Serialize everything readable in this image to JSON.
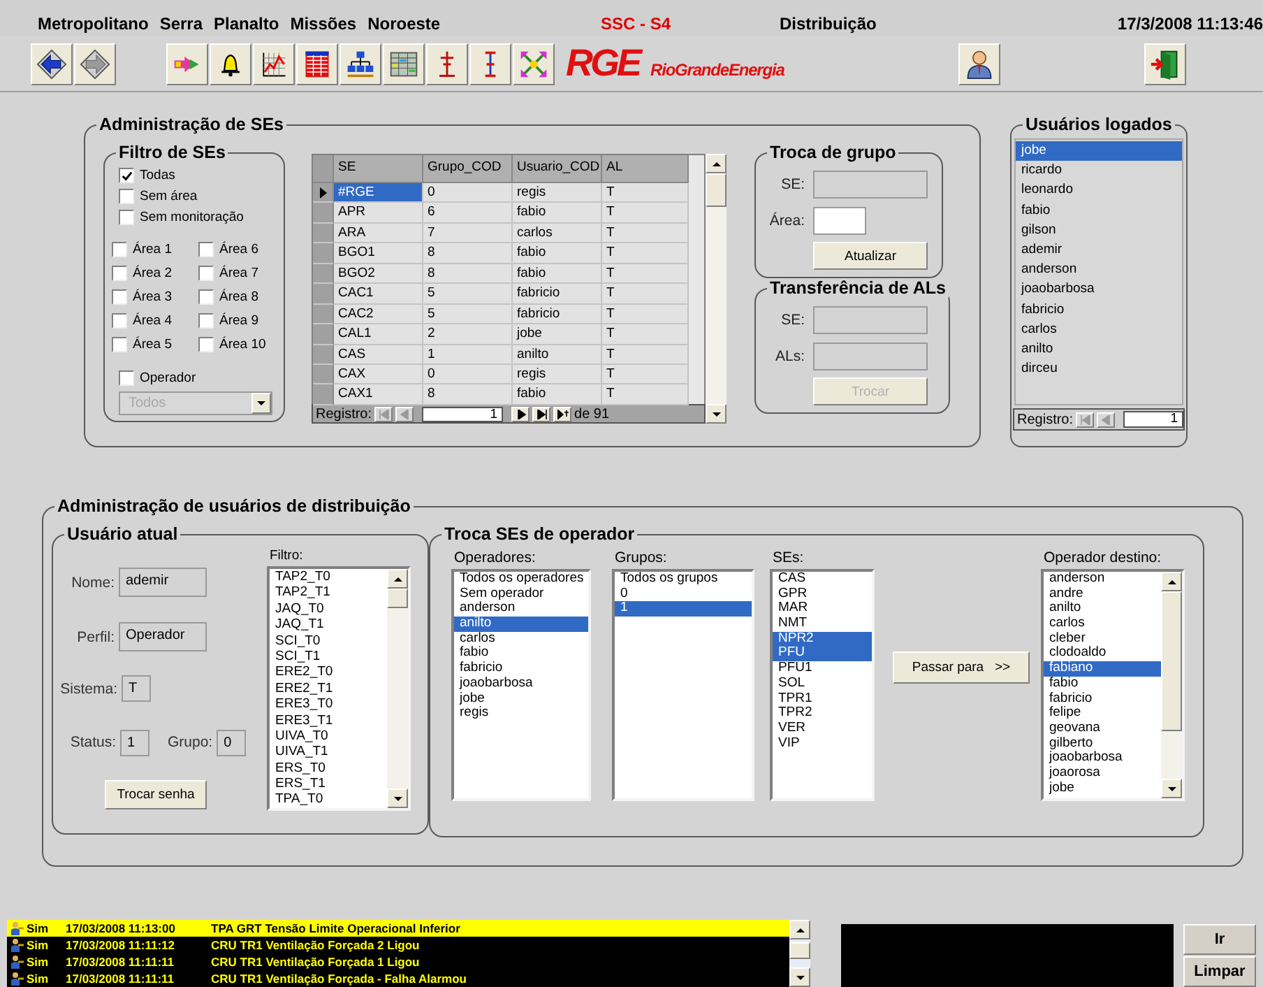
{
  "menu": [
    "Metropolitano",
    "Serra",
    "Planalto",
    "Missões",
    "Noroeste"
  ],
  "app_title": "SSC - S4",
  "module": "Distribuição",
  "datetime": "17/3/2008 11:13:46",
  "logo": {
    "mark": "RGE",
    "wordmark": "RioGrandeEnergia"
  },
  "se_admin": {
    "title": "Administração de SEs",
    "filter": {
      "title": "Filtro de SEs",
      "options": [
        {
          "label": "Todas",
          "checked": true
        },
        {
          "label": "Sem área",
          "checked": false
        },
        {
          "label": "Sem monitoração",
          "checked": false
        }
      ],
      "areas": [
        {
          "label": "Área 1",
          "checked": false
        },
        {
          "label": "Área 2",
          "checked": false
        },
        {
          "label": "Área 3",
          "checked": false
        },
        {
          "label": "Área 4",
          "checked": false
        },
        {
          "label": "Área 5",
          "checked": false
        },
        {
          "label": "Área 6",
          "checked": false
        },
        {
          "label": "Área 7",
          "checked": false
        },
        {
          "label": "Área 8",
          "checked": false
        },
        {
          "label": "Área 9",
          "checked": false
        },
        {
          "label": "Área 10",
          "checked": false
        }
      ],
      "operator": {
        "label": "Operador",
        "checked": false
      },
      "operator_select": {
        "value": "Todos",
        "disabled": true
      }
    },
    "table": {
      "columns": [
        "SE",
        "Grupo_COD",
        "Usuario_COD",
        "AL"
      ],
      "rows": [
        {
          "cells": [
            "#RGE",
            "0",
            "regis",
            "T"
          ],
          "selected": true
        },
        {
          "cells": [
            "APR",
            "6",
            "fabio",
            "T"
          ],
          "selected": false
        },
        {
          "cells": [
            "ARA",
            "7",
            "carlos",
            "T"
          ],
          "selected": false
        },
        {
          "cells": [
            "BGO1",
            "8",
            "fabio",
            "T"
          ],
          "selected": false
        },
        {
          "cells": [
            "BGO2",
            "8",
            "fabio",
            "T"
          ],
          "selected": false
        },
        {
          "cells": [
            "CAC1",
            "5",
            "fabricio",
            "T"
          ],
          "selected": false
        },
        {
          "cells": [
            "CAC2",
            "5",
            "fabricio",
            "T"
          ],
          "selected": false
        },
        {
          "cells": [
            "CAL1",
            "2",
            "jobe",
            "T"
          ],
          "selected": false
        },
        {
          "cells": [
            "CAS",
            "1",
            "anilto",
            "T"
          ],
          "selected": false
        },
        {
          "cells": [
            "CAX",
            "0",
            "regis",
            "T"
          ],
          "selected": false
        },
        {
          "cells": [
            "CAX1",
            "8",
            "fabio",
            "T"
          ],
          "selected": false
        }
      ],
      "navigator": {
        "label": "Registro:",
        "value": "1",
        "total": "de 91"
      }
    },
    "group_change": {
      "title": "Troca de grupo",
      "se_label": "SE:",
      "area_label": "Área:",
      "button": {
        "label": "Atualizar",
        "disabled": false
      }
    },
    "al_transfer": {
      "title": "Transferência de ALs",
      "se_label": "SE:",
      "als_label": "ALs:",
      "button": {
        "label": "Trocar",
        "disabled": true
      }
    }
  },
  "logged_users": {
    "title": "Usuários logados",
    "items": [
      {
        "label": "jobe",
        "selected": true
      },
      {
        "label": "ricardo",
        "selected": false
      },
      {
        "label": "leonardo",
        "selected": false
      },
      {
        "label": "fabio",
        "selected": false
      },
      {
        "label": "gilson",
        "selected": false
      },
      {
        "label": "ademir",
        "selected": false
      },
      {
        "label": "anderson",
        "selected": false
      },
      {
        "label": "joaobarbosa",
        "selected": false
      },
      {
        "label": "fabricio",
        "selected": false
      },
      {
        "label": "carlos",
        "selected": false
      },
      {
        "label": "anilto",
        "selected": false
      },
      {
        "label": "dirceu",
        "selected": false
      }
    ],
    "navigator": {
      "label": "Registro:",
      "value": "1"
    }
  },
  "user_admin": {
    "title": "Administração de usuários de distribuição",
    "current_user": {
      "title": "Usuário atual",
      "fields": [
        {
          "label": "Nome:",
          "value": "ademir"
        },
        {
          "label": "Perfil:",
          "value": "Operador"
        },
        {
          "label": "Sistema:",
          "value": "T"
        },
        {
          "label": "Status:",
          "value": "1"
        },
        {
          "label": "Grupo:",
          "value": "0"
        }
      ],
      "button": "Trocar senha",
      "filter_label": "Filtro:",
      "filter_items": [
        "TAP2_T0",
        "TAP2_T1",
        "JAQ_T0",
        "JAQ_T1",
        "SCI_T0",
        "SCI_T1",
        "ERE2_T0",
        "ERE2_T1",
        "ERE3_T0",
        "ERE3_T1",
        "UIVA_T0",
        "UIVA_T1",
        "ERS_T0",
        "ERS_T1",
        "TPA_T0"
      ]
    },
    "operator_change": {
      "title": "Troca SEs de operador",
      "lists": [
        {
          "label": "Operadores:",
          "items": [
            {
              "label": "Todos os operadores",
              "selected": false
            },
            {
              "label": "Sem operador",
              "selected": false
            },
            {
              "label": "anderson",
              "selected": false
            },
            {
              "label": "anilto",
              "selected": true
            },
            {
              "label": "carlos",
              "selected": false
            },
            {
              "label": "fabio",
              "selected": false
            },
            {
              "label": "fabricio",
              "selected": false
            },
            {
              "label": "joaobarbosa",
              "selected": false
            },
            {
              "label": "jobe",
              "selected": false
            },
            {
              "label": "regis",
              "selected": false
            }
          ]
        },
        {
          "label": "Grupos:",
          "items": [
            {
              "label": "Todos os grupos",
              "selected": false
            },
            {
              "label": "0",
              "selected": false
            },
            {
              "label": "1",
              "selected": true
            }
          ]
        },
        {
          "label": "SEs:",
          "items": [
            {
              "label": "CAS",
              "selected": false
            },
            {
              "label": "GPR",
              "selected": false
            },
            {
              "label": "MAR",
              "selected": false
            },
            {
              "label": "NMT",
              "selected": false
            },
            {
              "label": "NPR2",
              "selected": true
            },
            {
              "label": "PFU",
              "selected": true
            },
            {
              "label": "PFU1",
              "selected": false
            },
            {
              "label": "SOL",
              "selected": false
            },
            {
              "label": "TPR1",
              "selected": false
            },
            {
              "label": "TPR2",
              "selected": false
            },
            {
              "label": "VER",
              "selected": false
            },
            {
              "label": "VIP",
              "selected": false
            }
          ]
        }
      ],
      "button": "Passar para   >>",
      "destination": {
        "label": "Operador destino:",
        "items": [
          {
            "label": "anderson",
            "selected": false
          },
          {
            "label": "andre",
            "selected": false
          },
          {
            "label": "anilto",
            "selected": false
          },
          {
            "label": "carlos",
            "selected": false
          },
          {
            "label": "cleber",
            "selected": false
          },
          {
            "label": "clodoaldo",
            "selected": false
          },
          {
            "label": "fabiano",
            "selected": true
          },
          {
            "label": "fabio",
            "selected": false
          },
          {
            "label": "fabricio",
            "selected": false
          },
          {
            "label": "felipe",
            "selected": false
          },
          {
            "label": "geovana",
            "selected": false
          },
          {
            "label": "gilberto",
            "selected": false
          },
          {
            "label": "joaobarbosa",
            "selected": false
          },
          {
            "label": "joaorosa",
            "selected": false
          },
          {
            "label": "jobe",
            "selected": false
          }
        ]
      }
    }
  },
  "alarms": [
    {
      "ack": "Sim",
      "time": "17/03/2008 11:13:00",
      "message": "TPA GRT Tensão Limite Operacional Inferior",
      "highlighted": true
    },
    {
      "ack": "Sim",
      "time": "17/03/2008 11:11:12",
      "message": "CRU TR1 Ventilação Forçada 2 Ligou",
      "highlighted": false
    },
    {
      "ack": "Sim",
      "time": "17/03/2008 11:11:11",
      "message": "CRU TR1 Ventilação Forçada 1 Ligou",
      "highlighted": false
    },
    {
      "ack": "Sim",
      "time": "17/03/2008 11:11:11",
      "message": "CRU TR1 Ventilação Forçada - Falha Alarmou",
      "highlighted": false
    }
  ],
  "alarm_buttons": [
    "Ir",
    "Limpar"
  ]
}
